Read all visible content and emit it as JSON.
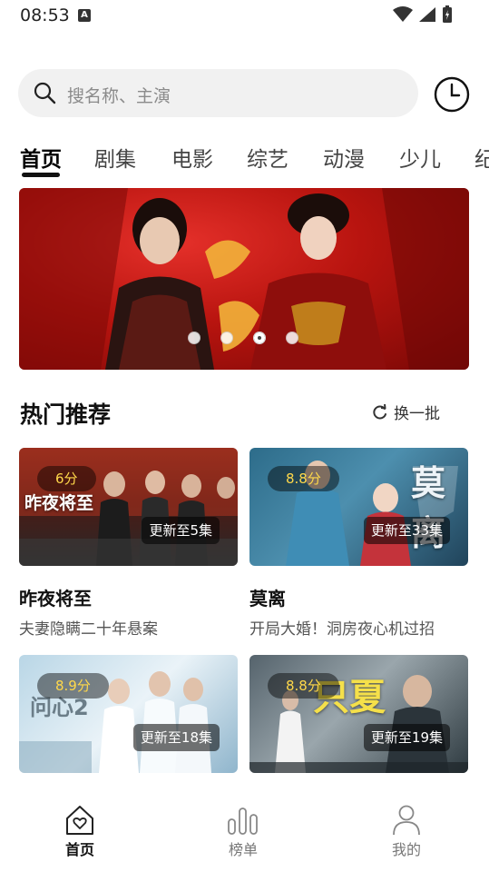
{
  "status": {
    "time": "08:53",
    "notify_glyph": "A"
  },
  "search": {
    "placeholder": "搜名称、主演"
  },
  "tabs": [
    {
      "label": "首页"
    },
    {
      "label": "剧集"
    },
    {
      "label": "电影"
    },
    {
      "label": "综艺"
    },
    {
      "label": "动漫"
    },
    {
      "label": "少儿"
    },
    {
      "label": "纪"
    }
  ],
  "banner": {
    "dots": 4,
    "active_dot": 2
  },
  "section": {
    "title": "热门推荐",
    "refresh_label": "换一批"
  },
  "cards": [
    {
      "score": "6分",
      "episodes": "更新至5集",
      "title": "昨夜将至",
      "desc": "夫妻隐瞒二十年悬案",
      "art_text": "昨夜将至"
    },
    {
      "score": "8.8分",
      "episodes": "更新至33集",
      "title": "莫离",
      "desc": "开局大婚！洞房夜心机过招",
      "art_text": "莫离"
    },
    {
      "score": "8.9分",
      "episodes": "更新至18集",
      "title": "",
      "desc": "",
      "art_text": "问心2"
    },
    {
      "score": "8.8分",
      "episodes": "更新至19集",
      "title": "",
      "desc": "",
      "art_text": "只夏"
    }
  ],
  "nav": [
    {
      "label": "首页",
      "icon": "home-heart-icon"
    },
    {
      "label": "榜单",
      "icon": "ranking-bars-icon"
    },
    {
      "label": "我的",
      "icon": "person-icon"
    }
  ],
  "colors": {
    "accent": "#111111",
    "score": "#ffd84a",
    "banner": "#b8140f"
  }
}
